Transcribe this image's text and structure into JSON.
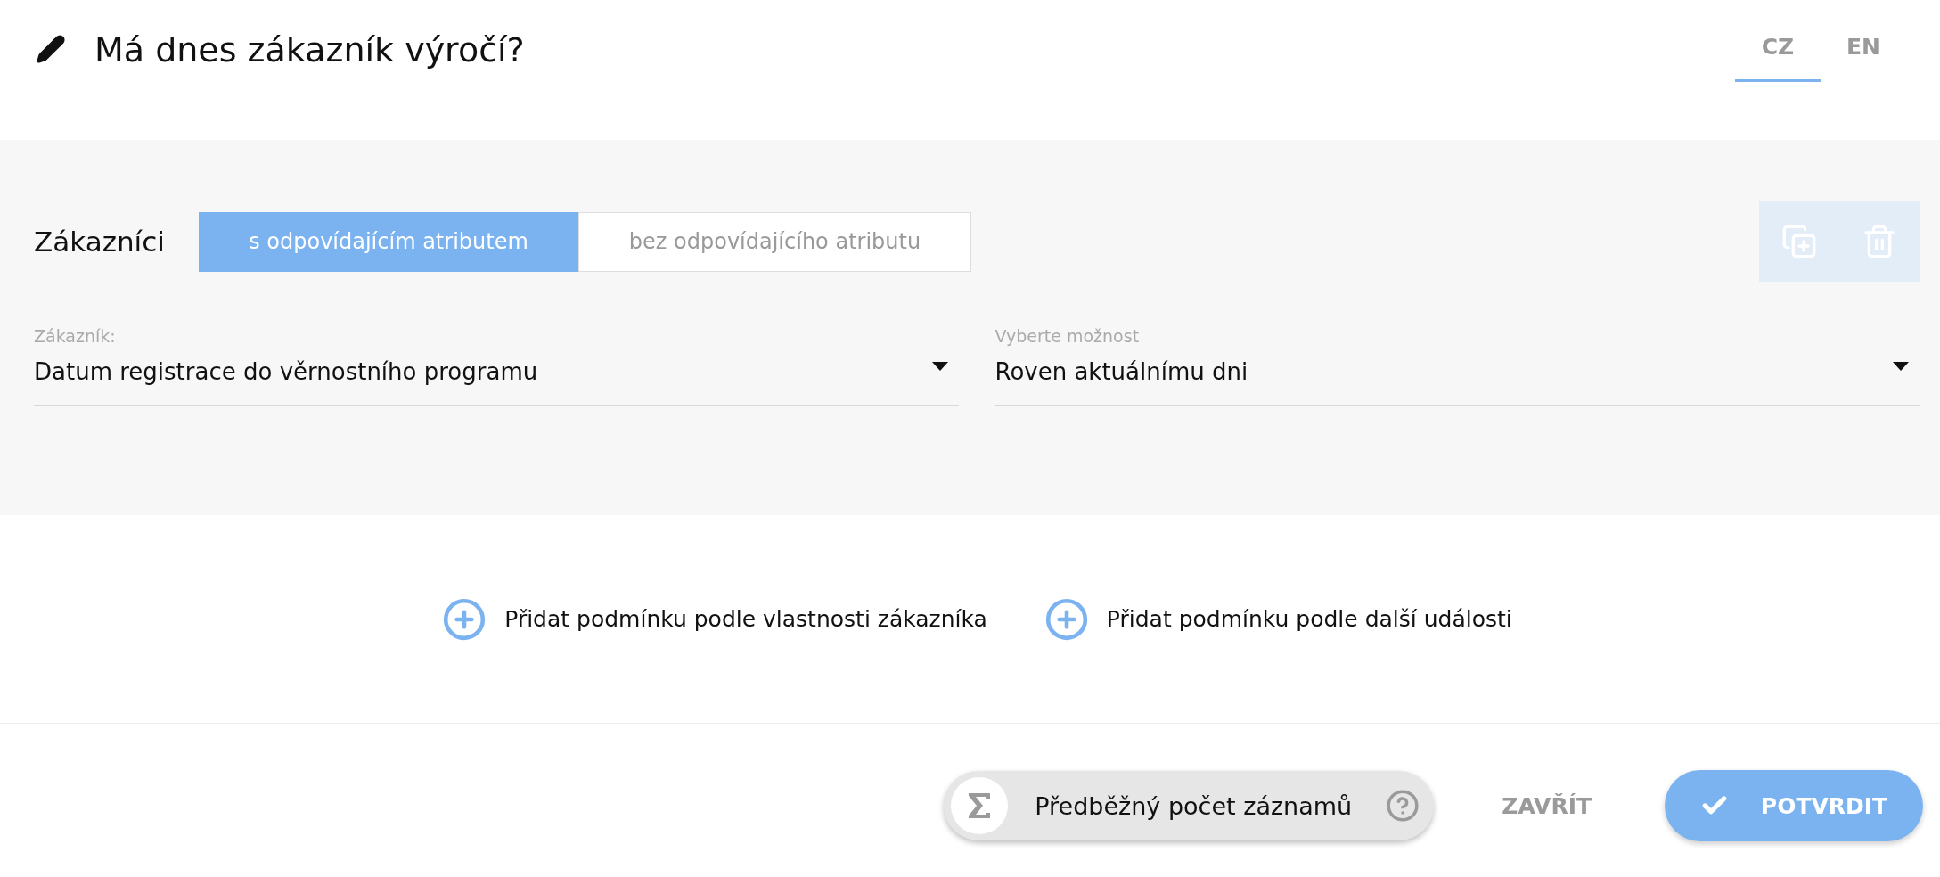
{
  "header": {
    "title": "Má dnes zákazník výročí?",
    "languages": [
      {
        "label": "CZ",
        "selected": true
      },
      {
        "label": "EN",
        "selected": false
      }
    ]
  },
  "condition": {
    "label": "Zákazníci",
    "modes": [
      {
        "label": "s odpovídajícím atributem",
        "selected": true
      },
      {
        "label": "bez odpovídajícího atributu",
        "selected": false
      }
    ],
    "actions_disabled": true,
    "fields": [
      {
        "label": "Zákazník:",
        "value": "Datum registrace do věrnostního programu"
      },
      {
        "label": "Vyberte možnost",
        "value": "Roven aktuálnímu dni"
      }
    ]
  },
  "add_links": [
    {
      "label": "Přidat podmínku podle vlastnosti zákazníka"
    },
    {
      "label": "Přidat podmínku podle další události"
    }
  ],
  "footer": {
    "estimate": "Předběžný počet záznamů",
    "close": "ZAVŘÍT",
    "confirm": "POTVRDIT"
  }
}
